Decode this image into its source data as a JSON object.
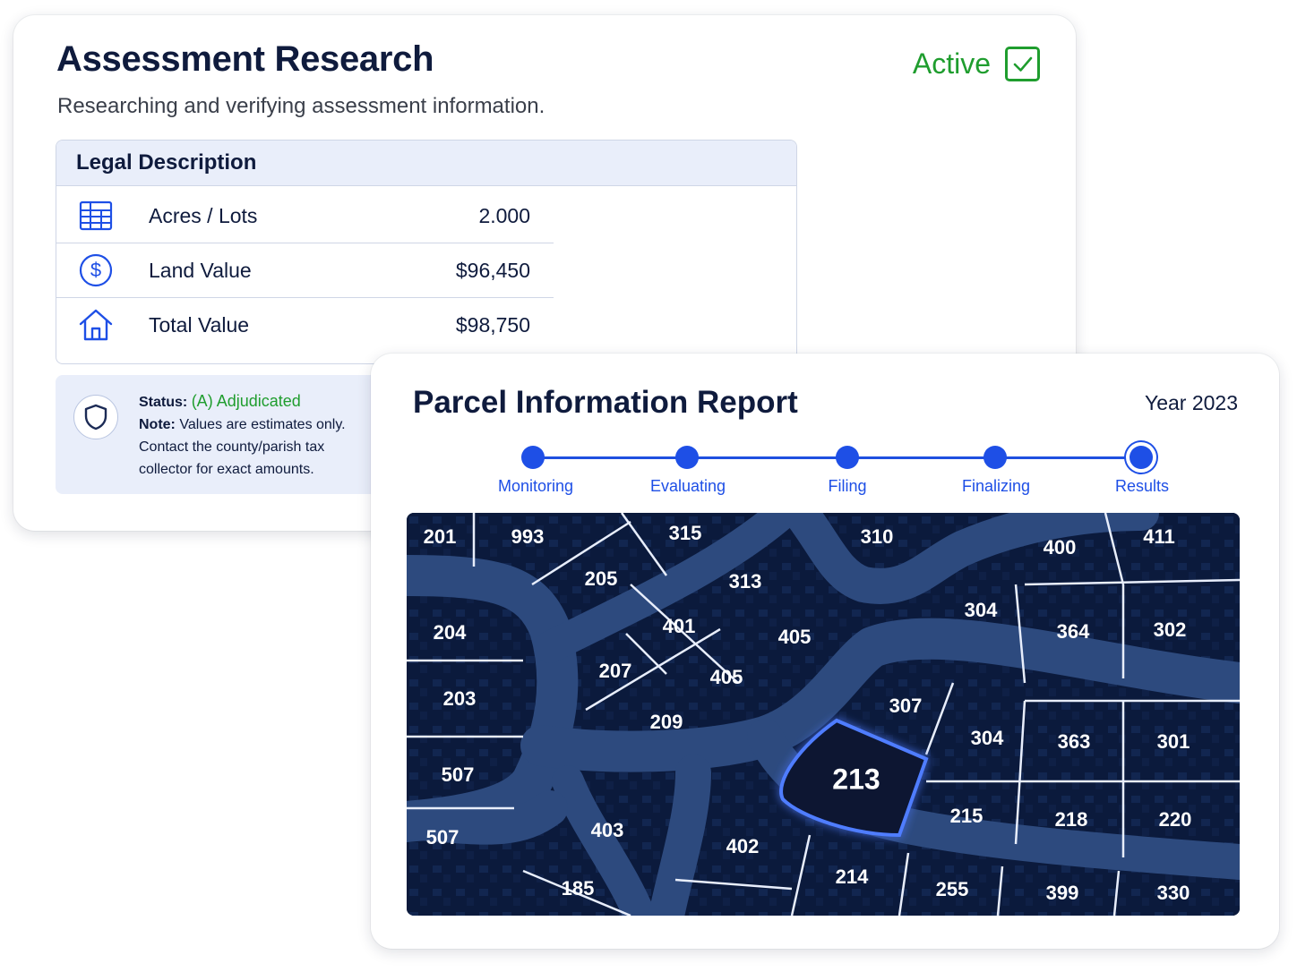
{
  "assessment": {
    "title": "Assessment Research",
    "subtitle": "Researching and verifying assessment information.",
    "status_label": "Active",
    "legal": {
      "header": "Legal Description",
      "rows": [
        {
          "icon": "grid-icon",
          "label": "Acres / Lots",
          "value": "2.000"
        },
        {
          "icon": "dollar-icon",
          "label": "Land Value",
          "value": "$96,450"
        },
        {
          "icon": "house-icon",
          "label": "Total Value",
          "value": "$98,750"
        }
      ]
    },
    "note": {
      "status_prefix": "Status:",
      "status_value": "(A) Adjudicated",
      "note_prefix": "Note:",
      "note_line1": "Values are estimates only.",
      "note_line2": "Contact the county/parish tax",
      "note_line3": "collector for exact amounts."
    }
  },
  "parcel": {
    "title": "Parcel Information Report",
    "year": "Year 2023",
    "steps": [
      "Monitoring",
      "Evaluating",
      "Filing",
      "Finalizing",
      "Results"
    ],
    "current_step": "Results",
    "selected_lot": "213",
    "lots": [
      "201",
      "993",
      "315",
      "310",
      "400",
      "411",
      "205",
      "313",
      "304",
      "204",
      "401",
      "405",
      "364",
      "302",
      "207",
      "405",
      "307",
      "203",
      "209",
      "304",
      "363",
      "301",
      "213",
      "507",
      "215",
      "218",
      "220",
      "507",
      "403",
      "402",
      "214",
      "255",
      "399",
      "330",
      "185"
    ]
  },
  "colors": {
    "accent": "#1e4fe6",
    "active_green": "#1f9d2e",
    "map_bg": "#0b1a3c",
    "road": "#2d4a7e"
  }
}
